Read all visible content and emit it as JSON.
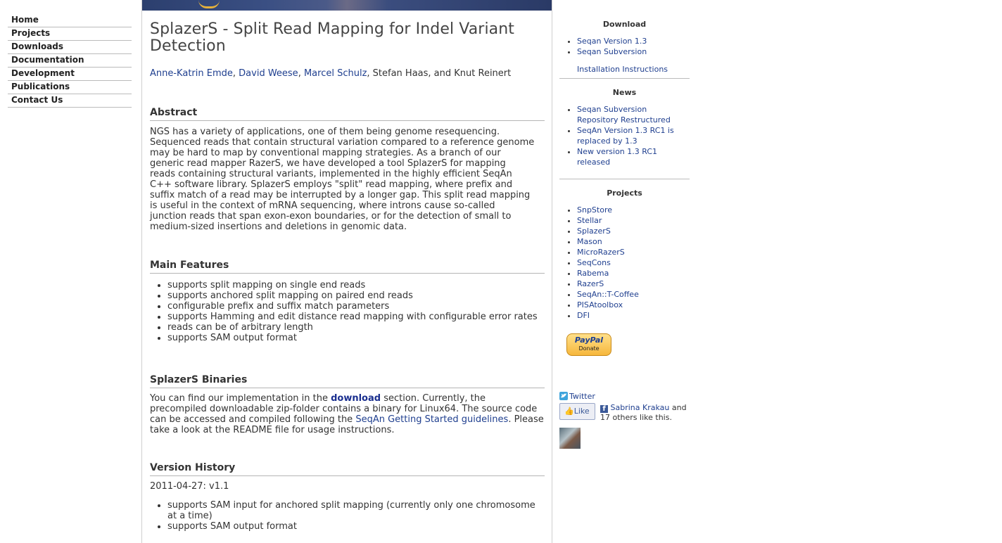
{
  "nav": [
    "Home",
    "Projects",
    "Downloads",
    "Documentation",
    "Development",
    "Publications",
    "Contact Us"
  ],
  "page_title": "SplazerS - Split Read Mapping for Indel Variant Detection",
  "authors": {
    "a1": "Anne-Katrin Emde",
    "a2": "David Weese",
    "a3": "Marcel Schulz",
    "rest": ", Stefan Haas, and Knut Reinert"
  },
  "abstract": {
    "heading": "Abstract",
    "lines": [
      "NGS has a variety of applications, one of them being genome resequencing.",
      "Sequenced reads that contain structural variation compared to a reference genome",
      "may be hard to map by conventional mapping strategies. As a branch of our",
      "generic read mapper RazerS, we have developed a tool SplazerS for mapping",
      "reads containing structural variants, implemented in the highly efficient SeqAn",
      "C++ software library. SplazerS employs \"split\" read mapping, where prefix and",
      "suffix match of a read may be interrupted by a longer gap. This split read mapping",
      "is useful in the context of mRNA sequencing, where introns cause so-called",
      "junction reads that span exon-exon boundaries, or for the detection of small to",
      "medium-sized insertions and deletions in genomic data."
    ]
  },
  "features": {
    "heading": "Main Features",
    "items": [
      "supports split mapping on single end reads",
      "supports anchored split mapping on paired end reads",
      "configurable prefix and suffix match parameters",
      "supports Hamming and edit distance read mapping with configurable error rates",
      "reads can be of arbitrary length",
      "supports SAM output format"
    ]
  },
  "binaries": {
    "heading": "SplazerS Binaries",
    "t1": "You can find our implementation in the ",
    "link1": "download",
    "t2": " section. Currently, the precompiled downloadable zip-folder contains a binary for Linux64. The source code can be accessed and compiled following the ",
    "link2": "SeqAn Getting Started guidelines",
    "t3": ". Please take a look at the README file for usage instructions."
  },
  "history": {
    "heading": "Version History",
    "version": "2011-04-27: v1.1",
    "items": [
      "supports SAM input for anchored split mapping (currently only one chromosome at a time)",
      "supports SAM output format"
    ]
  },
  "sidebar": {
    "download_heading": "Download",
    "download_links": [
      "Seqan Version 1.3",
      "Seqan Subversion"
    ],
    "install": "Installation Instructions",
    "news_heading": "News",
    "news": [
      "Seqan Subversion Repository Restructured",
      "SeqAn Version 1.3 RC1 is replaced by 1.3",
      "New version 1.3 RC1 released"
    ],
    "projects_heading": "Projects",
    "projects": [
      "SnpStore",
      "Stellar",
      "SplazerS",
      "Mason",
      "MicroRazerS",
      "SeqCons",
      "Rabema",
      "RazerS",
      "SeqAn::T-Coffee",
      "PISAtoolbox",
      "DFI"
    ],
    "paypal_brand": "PayPal",
    "paypal_label": "Donate",
    "twitter": "Twitter",
    "like_label": "Like",
    "fb_name": "Sabrina Krakau",
    "fb_rest1": " and",
    "fb_rest2": "17 others like this."
  }
}
